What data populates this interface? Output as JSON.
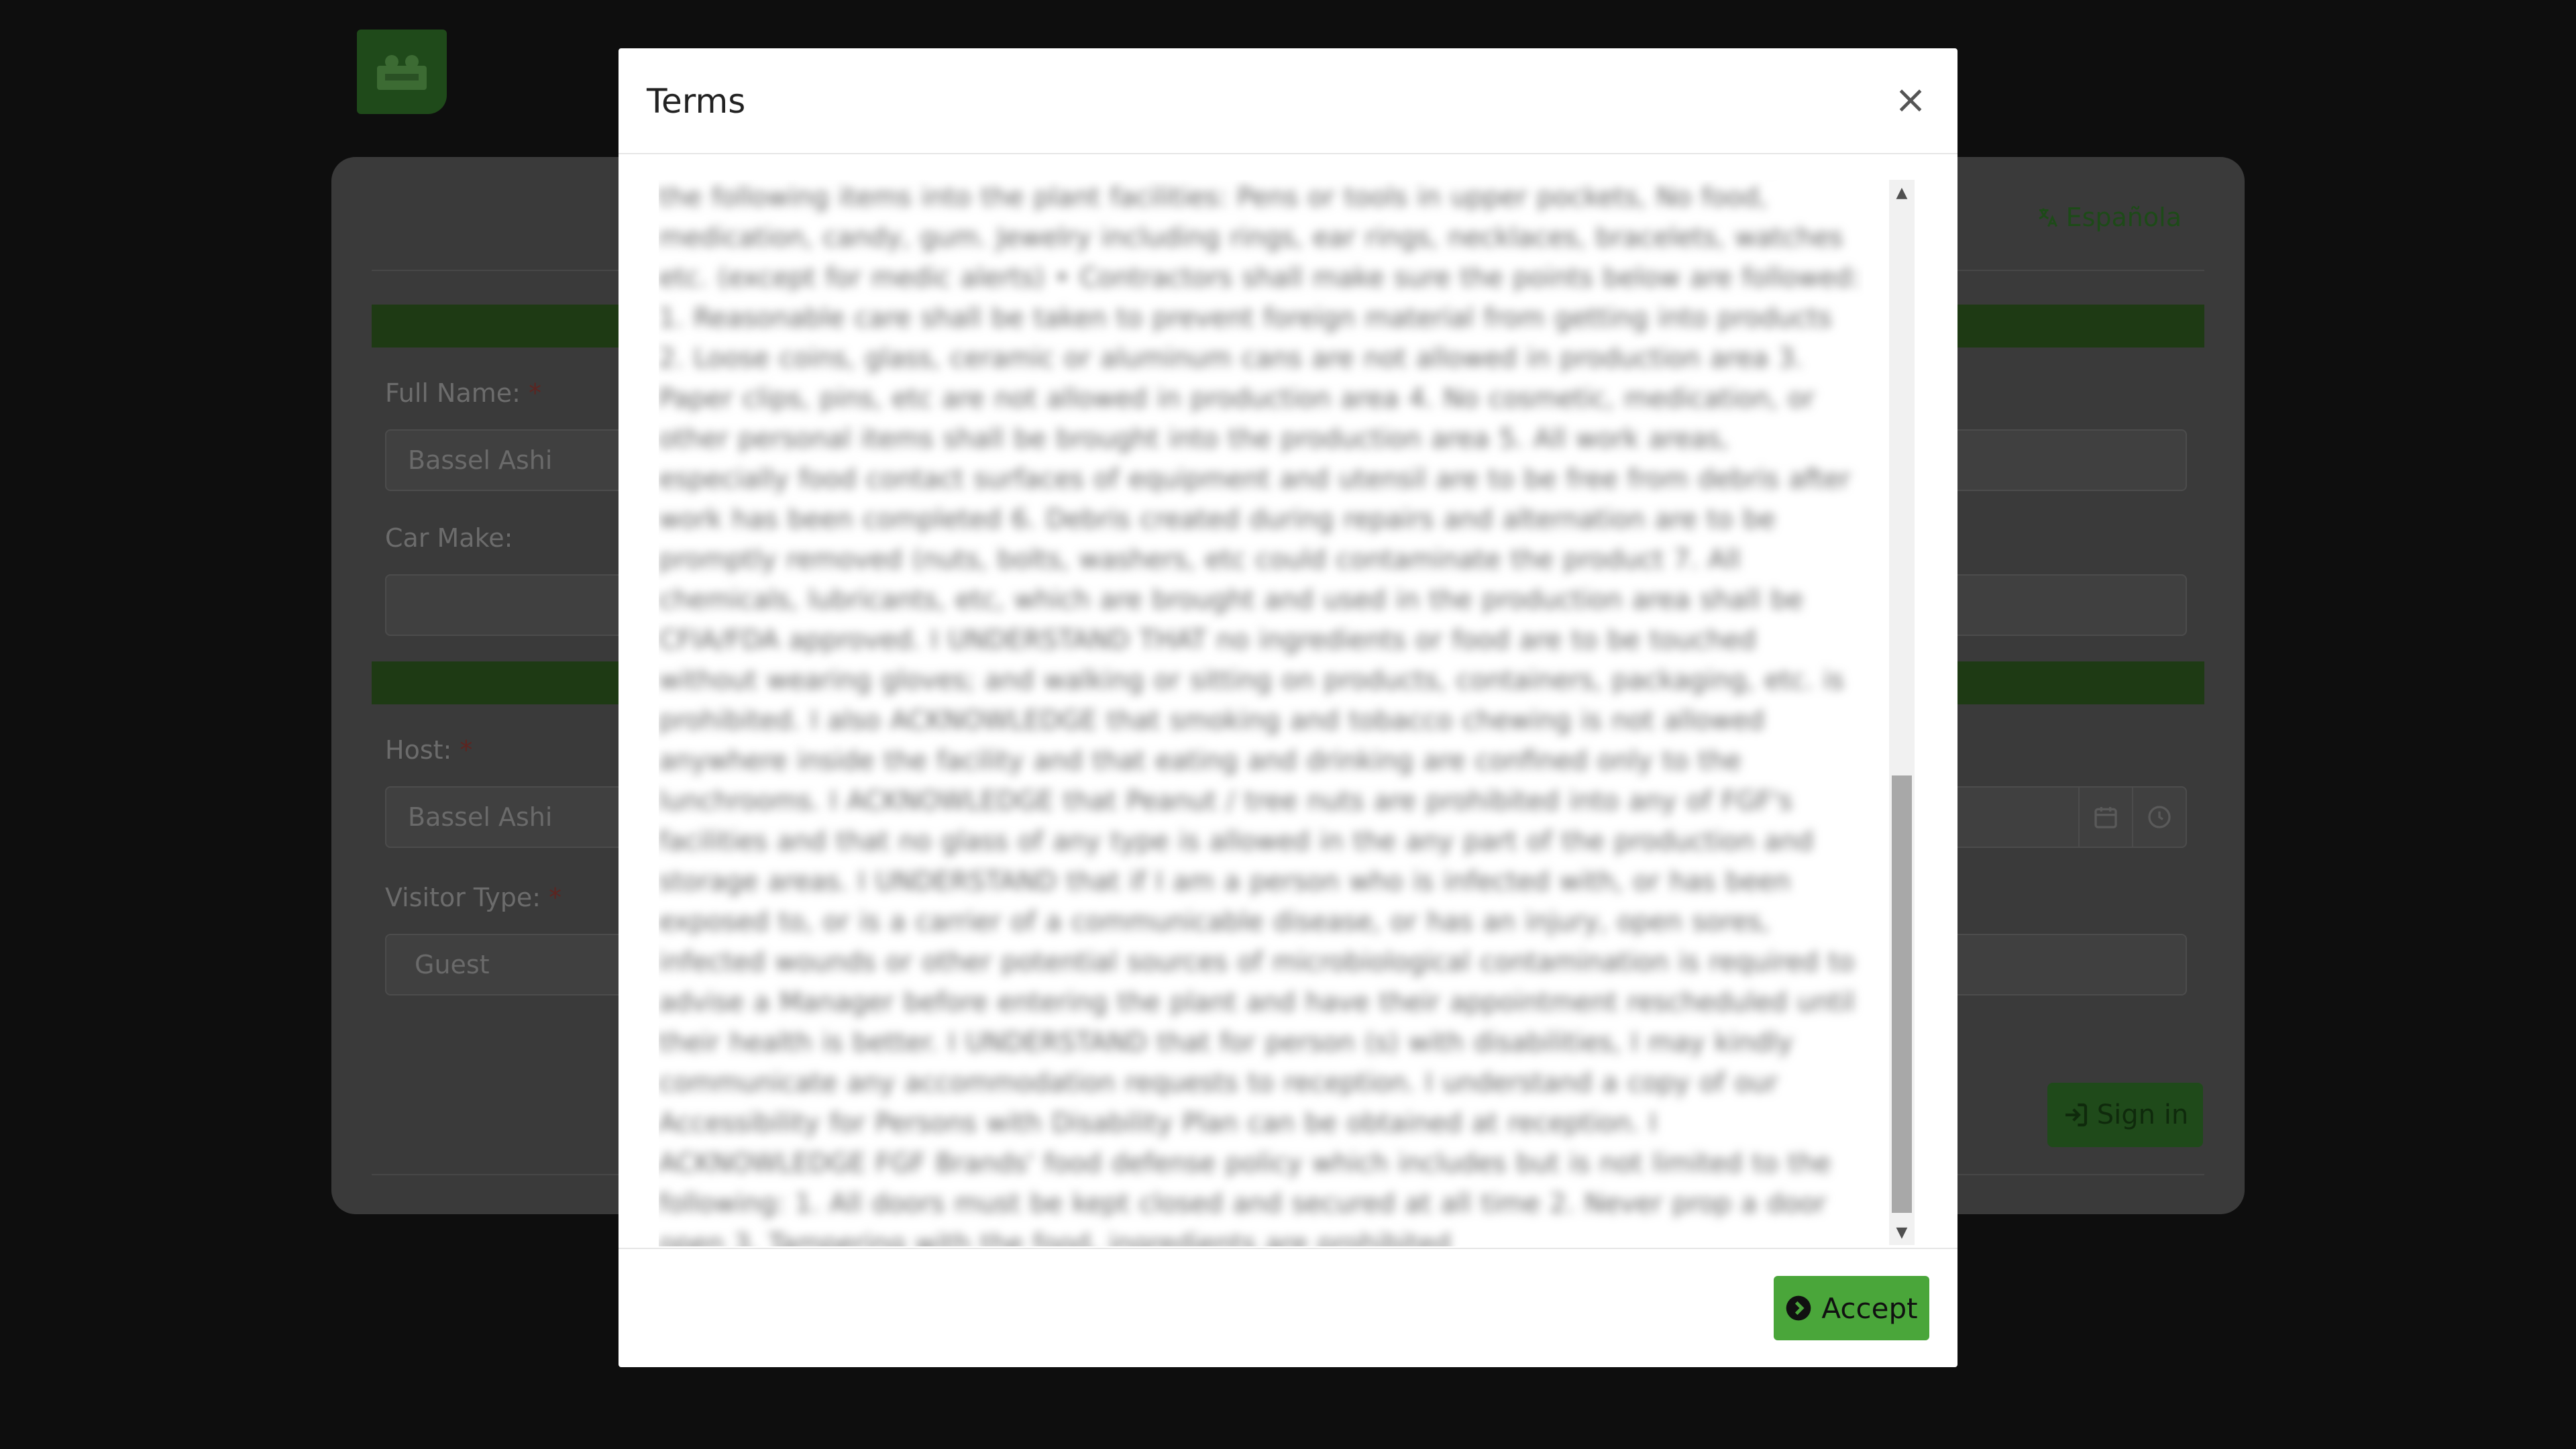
{
  "page": {
    "language_link": "Española",
    "fields": {
      "full_name": {
        "label": "Full Name:",
        "required_mark": "*",
        "value": "Bassel Ashi"
      },
      "car_make": {
        "label": "Car Make:",
        "value": ""
      },
      "host": {
        "label": "Host:",
        "required_mark": "*",
        "value": "Bassel Ashi"
      },
      "visitor_type": {
        "label": "Visitor Type:",
        "required_mark": "*",
        "value": "Guest"
      }
    },
    "sign_in_label": "Sign in"
  },
  "modal": {
    "title": "Terms",
    "close_symbol": "×",
    "terms_text": "Band-Aids must be company approved. • Ensure I washed and sanitized my hands before entering the plant, before and after lunch and bathroom breaks. • Will not bring any of the following items into the plant facilities: Pens or tools in upper pockets, No food, medication, candy, gum. Jewelry including rings, ear rings, necklaces, bracelets, watches etc. (except for medic alerts) • Contractors shall make sure the points below are followed: 1. Reasonable care shall be taken to prevent foreign material from getting into products 2. Loose coins, glass, ceramic or aluminum cans are not allowed in production area 3. Paper clips, pins, etc are not allowed in production area 4. No cosmetic, medication, or other personal items shall be brought into the production area 5. All work areas, especially food contact surfaces of equipment and utensil are to be free from debris after work has been completed 6. Debris created during repairs and alternation are to be promptly removed (nuts, bolts, washers, etc could contaminate the product 7. All chemicals, lubricants, etc, which are brought and used in the production area shall be CFIA/FDA approved. I UNDERSTAND THAT no ingredients or food are to be touched without wearing gloves; and walking or sitting on products, containers, packaging, etc. is prohibited. I also ACKNOWLEDGE that smoking and tobacco chewing is not allowed anywhere inside the facility and that eating and drinking are confined only to the lunchrooms. I ACKNOWLEDGE that Peanut / tree nuts are prohibited into any of FGF's facilities and that no glass of any type is allowed in the any part of the production and storage areas. I UNDERSTAND that if I am a person who is infected with, or has been exposed to, or is a carrier of a communicable disease, or has an injury, open sores, infected wounds or other potential sources of microbiological contamination is required to advise a Manager before entering the plant and have their appointment rescheduled until their health is better. I UNDERSTAND that for person (s) with disabilities, I may kindly communicate any accommodation requests to reception. I understand a copy of our Accessibility for Persons with Disability Plan can be obtained at reception. I ACKNOWLEDGE FGF Brands' food defense policy which includes but is not limited to the following: 1. All doors must be kept closed and secured at all time 2. Never prop a door open 3. Tampering with the food, ingredients are prohibited",
    "accept_label": "Accept",
    "scroll_position": 0.82
  },
  "colors": {
    "accept_button": "#4aa63a",
    "overlay": "#000000"
  }
}
